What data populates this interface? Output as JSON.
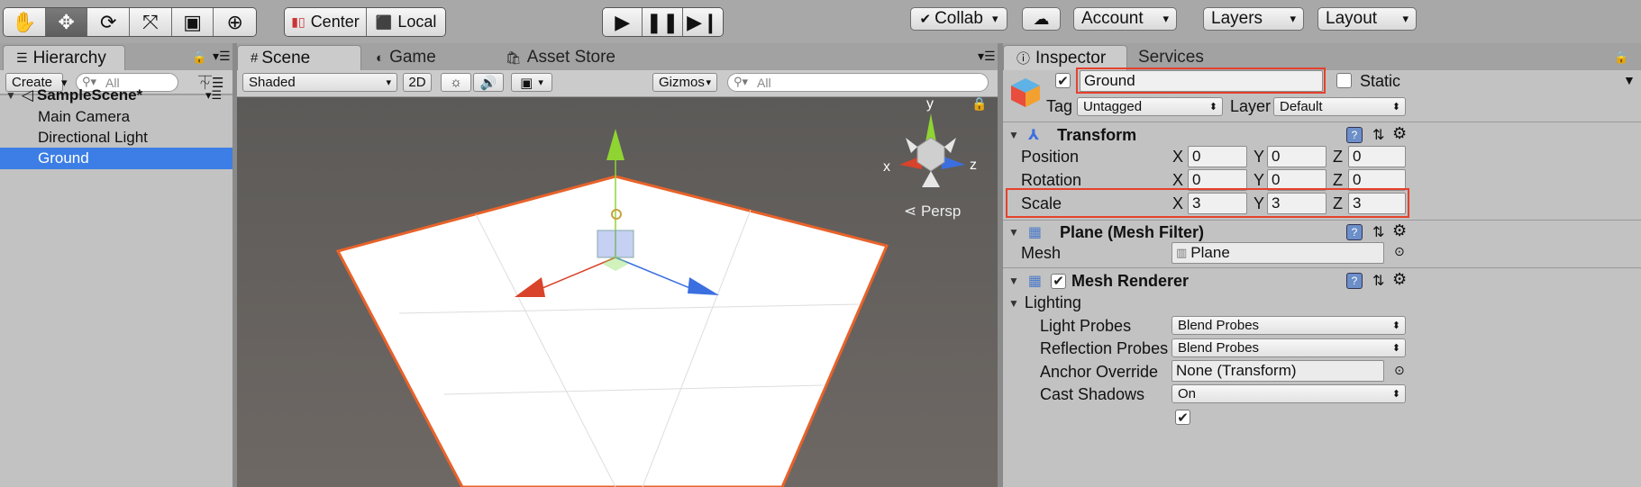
{
  "toolbar": {
    "pivot_mode": "Center",
    "pivot_rotation": "Local",
    "collab": "Collab",
    "account": "Account",
    "layers": "Layers",
    "layout": "Layout",
    "tools": [
      "hand-icon",
      "move-icon",
      "rotate-icon",
      "scale-icon",
      "rect-icon",
      "transform-icon"
    ],
    "play_icons": [
      "play-icon",
      "pause-icon",
      "step-icon"
    ]
  },
  "hierarchy": {
    "tab": "Hierarchy",
    "create": "Create",
    "search_placeholder": "All",
    "scene_name": "SampleScene*",
    "items": [
      {
        "label": "Main Camera"
      },
      {
        "label": "Directional Light"
      },
      {
        "label": "Ground"
      }
    ]
  },
  "scene": {
    "tabs": [
      "Scene",
      "Game",
      "Asset Store"
    ],
    "shading": "Shaded",
    "mode_2d": "2D",
    "gizmos": "Gizmos",
    "search_placeholder": "All",
    "persp_label": "Persp",
    "gizmo_axes": {
      "x": "x",
      "y": "y",
      "z": "z"
    }
  },
  "inspector": {
    "tabs": [
      "Inspector",
      "Services"
    ],
    "object_name": "Ground",
    "static_label": "Static",
    "tag_label": "Tag",
    "tag_value": "Untagged",
    "layer_label": "Layer",
    "layer_value": "Default",
    "transform": {
      "title": "Transform",
      "position_label": "Position",
      "rotation_label": "Rotation",
      "scale_label": "Scale",
      "axis_x": "X",
      "axis_y": "Y",
      "axis_z": "Z",
      "position": {
        "x": "0",
        "y": "0",
        "z": "0"
      },
      "rotation": {
        "x": "0",
        "y": "0",
        "z": "0"
      },
      "scale": {
        "x": "3",
        "y": "3",
        "z": "3"
      }
    },
    "mesh_filter": {
      "title": "Plane (Mesh Filter)",
      "mesh_label": "Mesh",
      "mesh_value": "Plane"
    },
    "mesh_renderer": {
      "title": "Mesh Renderer",
      "lighting_label": "Lighting",
      "light_probes_label": "Light Probes",
      "light_probes_value": "Blend Probes",
      "reflection_probes_label": "Reflection Probes",
      "reflection_probes_value": "Blend Probes",
      "anchor_override_label": "Anchor Override",
      "anchor_override_value": "None (Transform)",
      "cast_shadows_label": "Cast Shadows",
      "cast_shadows_value": "On"
    }
  },
  "colors": {
    "selection": "#3d7ee6",
    "highlight": "#e5412d",
    "axis_x": "#d9432b",
    "axis_y": "#8fd432",
    "axis_z": "#3b6fe0"
  }
}
